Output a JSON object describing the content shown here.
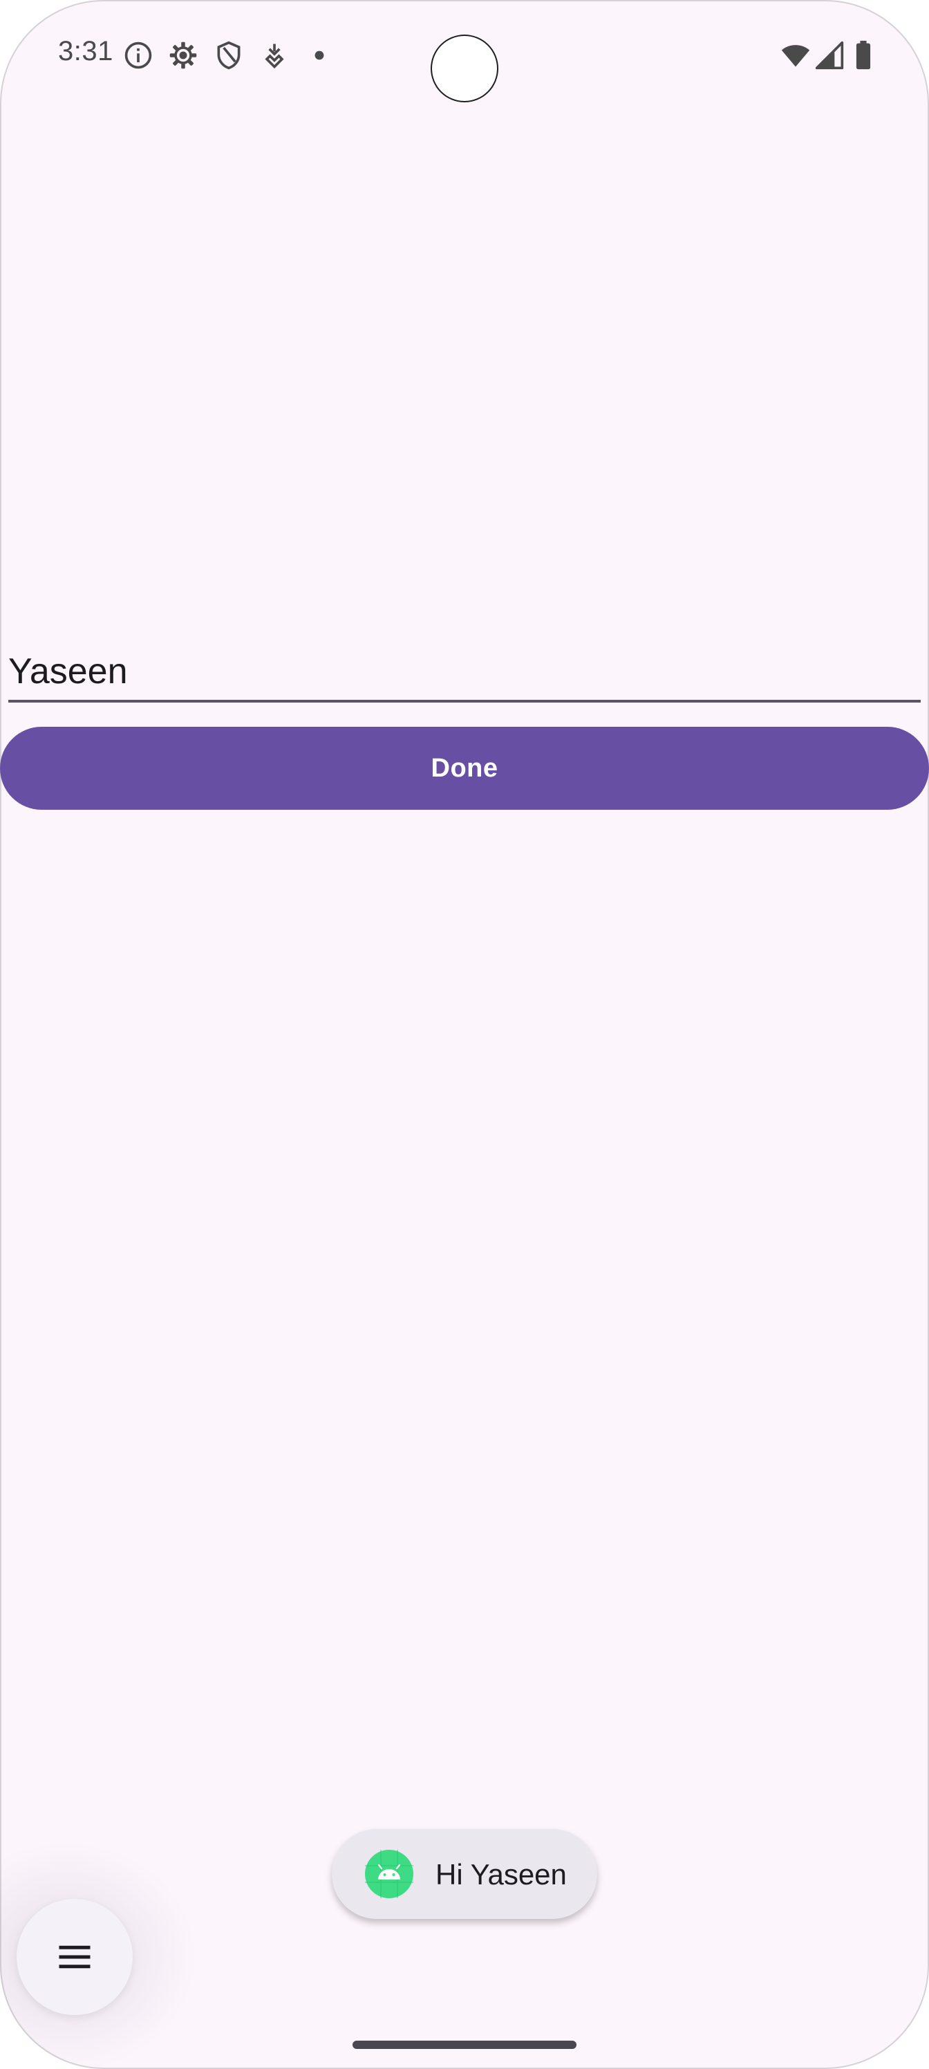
{
  "status_bar": {
    "time": "3:31",
    "icons": [
      "info-icon",
      "settings-icon",
      "shield-icon",
      "download-icon",
      "dot-icon",
      "wifi-icon",
      "signal-icon",
      "battery-icon"
    ]
  },
  "form": {
    "name_value": "Yaseen",
    "done_label": "Done"
  },
  "toast": {
    "icon": "android-icon",
    "message": "Hi Yaseen"
  },
  "fab": {
    "icon": "menu-icon"
  },
  "colors": {
    "background": "#fcf5fc",
    "primary": "#6750a4",
    "toast_background": "#ebe7ee",
    "android_green": "#3ddc84"
  }
}
